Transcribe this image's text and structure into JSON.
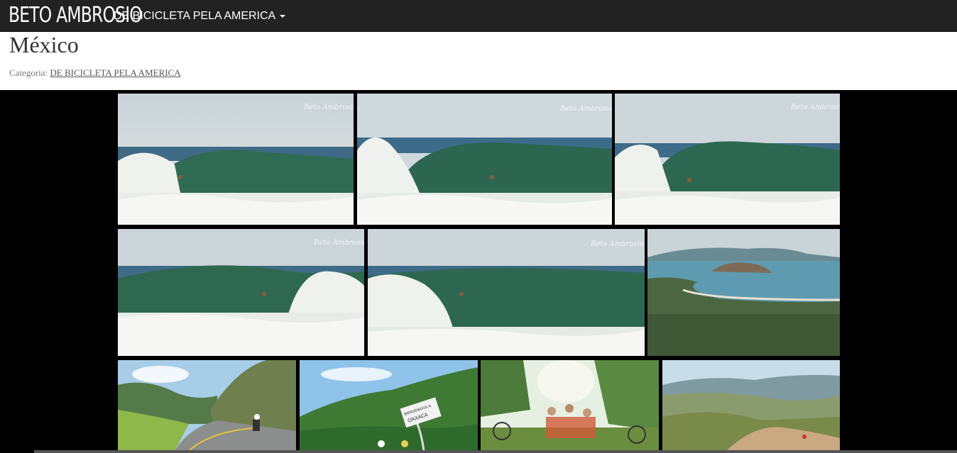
{
  "navbar": {
    "brand": "BETO AMBROSIO",
    "menu_label": "DE BICICLETA PELA AMERICA"
  },
  "post": {
    "title": "México",
    "category_prefix": "Categoria:",
    "category_link": "DE BICICLETA PELA AMERICA"
  },
  "gallery": {
    "photos": [
      {
        "name": "surf-photo-1",
        "subject": "surfer in barrel wave",
        "watermark": "Beto Ambrosio"
      },
      {
        "name": "surf-photo-2",
        "subject": "surfer under breaking wave",
        "watermark": "Beto Ambrosio"
      },
      {
        "name": "surf-photo-3",
        "subject": "surfer in barrel wave",
        "watermark": "Beto Ambrosio"
      },
      {
        "name": "surf-photo-4",
        "subject": "surfer riding wave left",
        "watermark": "Beto Ambrosio"
      },
      {
        "name": "surf-photo-5",
        "subject": "surfer inside barrel",
        "watermark": "Beto Ambrosio"
      },
      {
        "name": "coast-landscape-photo",
        "subject": "coastline with bay and hills"
      },
      {
        "name": "road-cycling-photo",
        "subject": "cyclist on mountain road"
      },
      {
        "name": "oaxaca-sign-photo",
        "subject": "cyclists at state sign",
        "sign_line_1": "BIENVENIDOS A",
        "sign_line_2": "OAXACA"
      },
      {
        "name": "group-photo",
        "subject": "group of people with bicycles in garden"
      },
      {
        "name": "mountain-cycling-photo",
        "subject": "cyclist on hill above valley"
      }
    ]
  },
  "colors": {
    "navbar_bg": "#222222",
    "gallery_bg": "#000000",
    "title_text": "#333333"
  }
}
